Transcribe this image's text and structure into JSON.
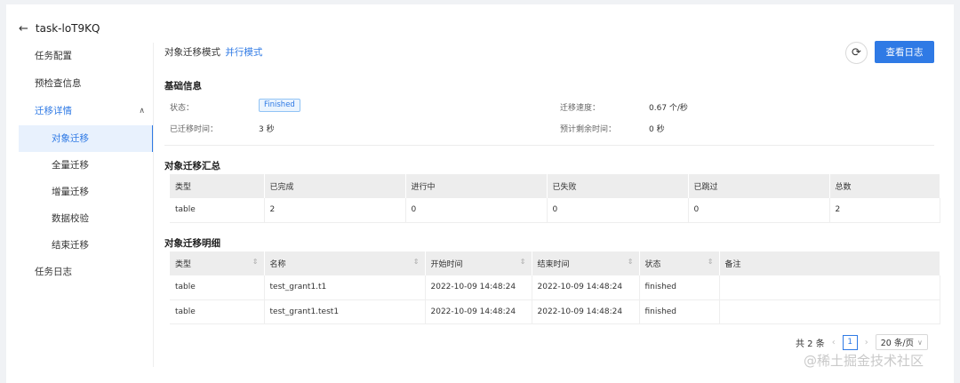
{
  "header": {
    "title": "task-loT9KQ"
  },
  "sidebar": {
    "items": [
      "任务配置",
      "预检查信息"
    ],
    "parent": "迁移详情",
    "sub_items": [
      "对象迁移",
      "全量迁移",
      "增量迁移",
      "数据校验",
      "结束迁移"
    ],
    "last_item": "任务日志"
  },
  "mode": {
    "label": "对象迁移模式",
    "value": "并行模式"
  },
  "toolbar": {
    "log_button": "查看日志"
  },
  "basic": {
    "title": "基础信息",
    "status_label": "状态：",
    "status_value": "Finished",
    "elapsed_label": "已迁移时间：",
    "elapsed_value": "3 秒",
    "speed_label": "迁移速度：",
    "speed_value": "0.67 个/秒",
    "remaining_label": "预计剩余时间：",
    "remaining_value": "0 秒"
  },
  "summary": {
    "title": "对象迁移汇总",
    "headers": [
      "类型",
      "已完成",
      "进行中",
      "已失败",
      "已跳过",
      "总数"
    ],
    "rows": [
      [
        "table",
        "2",
        "0",
        "0",
        "0",
        "2"
      ]
    ]
  },
  "detail": {
    "title": "对象迁移明细",
    "headers": [
      "类型",
      "名称",
      "开始时间",
      "结束时间",
      "状态",
      "备注"
    ],
    "rows": [
      [
        "table",
        "test_grant1.t1",
        "2022-10-09 14:48:24",
        "2022-10-09 14:48:24",
        "finished",
        ""
      ],
      [
        "table",
        "test_grant1.test1",
        "2022-10-09 14:48:24",
        "2022-10-09 14:48:24",
        "finished",
        ""
      ]
    ]
  },
  "pagination": {
    "total": "共 2 条",
    "current": "1",
    "page_size": "20 条/页"
  },
  "watermark": "@稀土掘金技术社区"
}
